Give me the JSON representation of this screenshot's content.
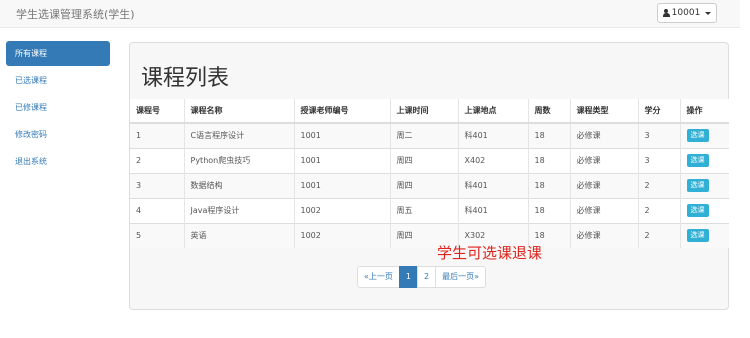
{
  "navbar": {
    "brand": "学生选课管理系统(学生)",
    "user": "10001"
  },
  "sidebar": {
    "items": [
      {
        "label": "所有课程",
        "active": true
      },
      {
        "label": "已选课程",
        "active": false
      },
      {
        "label": "已修课程",
        "active": false
      },
      {
        "label": "修改密码",
        "active": false
      },
      {
        "label": "退出系统",
        "active": false
      }
    ]
  },
  "main": {
    "title": "课程列表",
    "columns": [
      "课程号",
      "课程名称",
      "授课老师编号",
      "上课时间",
      "上课地点",
      "周数",
      "课程类型",
      "学分",
      "操作"
    ],
    "rows": [
      [
        "1",
        "C语言程序设计",
        "1001",
        "周二",
        "科401",
        "18",
        "必修课",
        "3",
        "选课"
      ],
      [
        "2",
        "Python爬虫技巧",
        "1001",
        "周四",
        "X402",
        "18",
        "必修课",
        "3",
        "选课"
      ],
      [
        "3",
        "数据结构",
        "1001",
        "周四",
        "科401",
        "18",
        "必修课",
        "2",
        "选课"
      ],
      [
        "4",
        "Java程序设计",
        "1002",
        "周五",
        "科401",
        "18",
        "必修课",
        "2",
        "选课"
      ],
      [
        "5",
        "英语",
        "1002",
        "周四",
        "X302",
        "18",
        "必修课",
        "2",
        "选课"
      ]
    ],
    "pagination": {
      "prev": "«上一页",
      "pages": [
        "1",
        "2"
      ],
      "current": "1",
      "last": "最后一页»"
    },
    "note": "学生可选课退课"
  },
  "colors": {
    "primary": "#337ab7",
    "info": "#31b0d5",
    "note": "#e0241d"
  }
}
